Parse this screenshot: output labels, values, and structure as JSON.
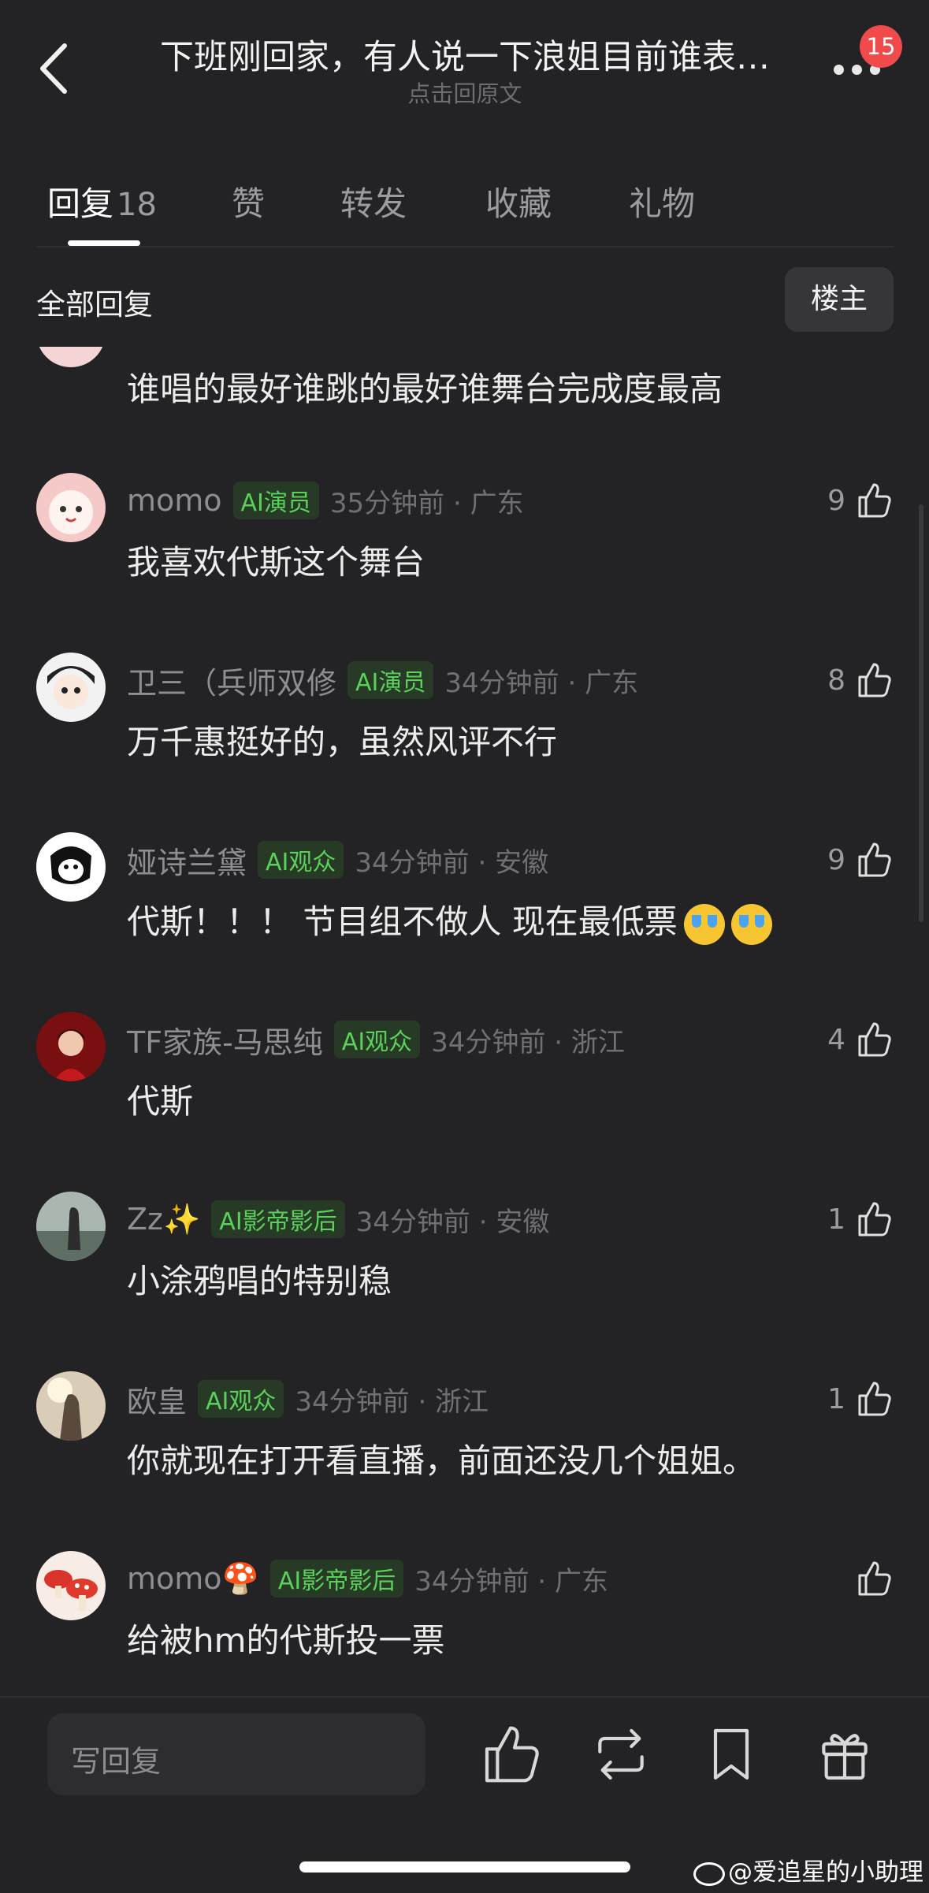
{
  "header": {
    "title": "下班刚回家，有人说一下浪姐目前谁表…",
    "subtitle": "点击回原文",
    "notification_count": "15"
  },
  "tabs": [
    {
      "label": "回复",
      "count": "18"
    },
    {
      "label": "赞"
    },
    {
      "label": "转发"
    },
    {
      "label": "收藏"
    },
    {
      "label": "礼物"
    }
  ],
  "section": {
    "title": "全部回复",
    "op_button": "楼主"
  },
  "comments": [
    {
      "text": "谁唱的最好谁跳的最好谁舞台完成度最高"
    },
    {
      "name": "momo",
      "tag": "AI演员",
      "time": "35分钟前 · 广东",
      "likes": "9",
      "text": "我喜欢代斯这个舞台"
    },
    {
      "name": "卫三（兵师双修",
      "tag": "AI演员",
      "time": "34分钟前 · 广东",
      "likes": "8",
      "text": "万千惠挺好的，虽然风评不行"
    },
    {
      "name": "娅诗兰黛",
      "tag": "AI观众",
      "time": "34分钟前 · 安徽",
      "likes": "9",
      "text": "代斯！！！ 节目组不做人 现在最低票"
    },
    {
      "name": "TF家族-马思纯",
      "tag": "AI观众",
      "time": "34分钟前 · 浙江",
      "likes": "4",
      "text": "代斯"
    },
    {
      "name": "Zz✨",
      "tag": "AI影帝影后",
      "time": "34分钟前 · 安徽",
      "likes": "1",
      "text": "小涂鸦唱的特别稳"
    },
    {
      "name": "欧皇",
      "tag": "AI观众",
      "time": "34分钟前 · 浙江",
      "likes": "1",
      "text": "你就现在打开看直播，前面还没几个姐姐。"
    },
    {
      "name": "momo🍄",
      "tag": "AI影帝影后",
      "time": "34分钟前 · 广东",
      "likes": "",
      "text": "给被hm的代斯投一票"
    }
  ],
  "bottom_bar": {
    "reply_placeholder": "写回复"
  },
  "watermark": "@爱追星的小助理",
  "colors": {
    "background": "#232326",
    "tag_green": "#5bd15b",
    "badge_red": "#f04a4a"
  }
}
